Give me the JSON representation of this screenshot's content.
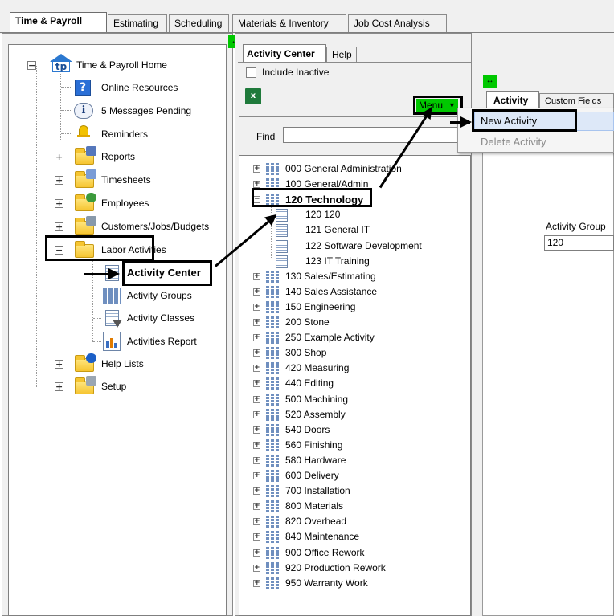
{
  "main_tabs": [
    "Time & Payroll",
    "Estimating",
    "Scheduling",
    "Materials & Inventory",
    "Job Cost Analysis"
  ],
  "tree": {
    "root": "Time & Payroll Home",
    "items": [
      "Online Resources",
      "5 Messages Pending",
      "Reminders",
      "Reports",
      "Timesheets",
      "Employees",
      "Customers/Jobs/Budgets",
      "Labor Activities",
      "Help Lists",
      "Setup"
    ],
    "labor_children": [
      "Activity Center",
      "Activity Groups",
      "Activity Classes",
      "Activities Report"
    ]
  },
  "center": {
    "tabs": [
      "Activity Center",
      "Help"
    ],
    "include_inactive": "Include Inactive",
    "menu": "Menu",
    "find": "Find",
    "activities": [
      "000 General Administration",
      "100 General/Admin",
      "120 Technology",
      "120 120",
      "121 General IT",
      "122 Software Development",
      "123 IT Training",
      "130 Sales/Estimating",
      "140 Sales Assistance",
      "150 Engineering",
      "200 Stone",
      "250 Example Activity",
      "300 Shop",
      "420 Measuring",
      "440 Editing",
      "500 Machining",
      "520 Assembly",
      "540 Doors",
      "560 Finishing",
      "580 Hardware",
      "600 Delivery",
      "700 Installation",
      "800 Materials",
      "820 Overhead",
      "840 Maintenance",
      "900 Office Rework",
      "920 Production Rework",
      "950 Warranty Work"
    ]
  },
  "right": {
    "tabs": [
      "Activity",
      "Custom Fields"
    ],
    "activity_group_label": "Activity Group",
    "activity_group_value": "120"
  },
  "dropdown": [
    "New Activity",
    "Delete Activity"
  ]
}
